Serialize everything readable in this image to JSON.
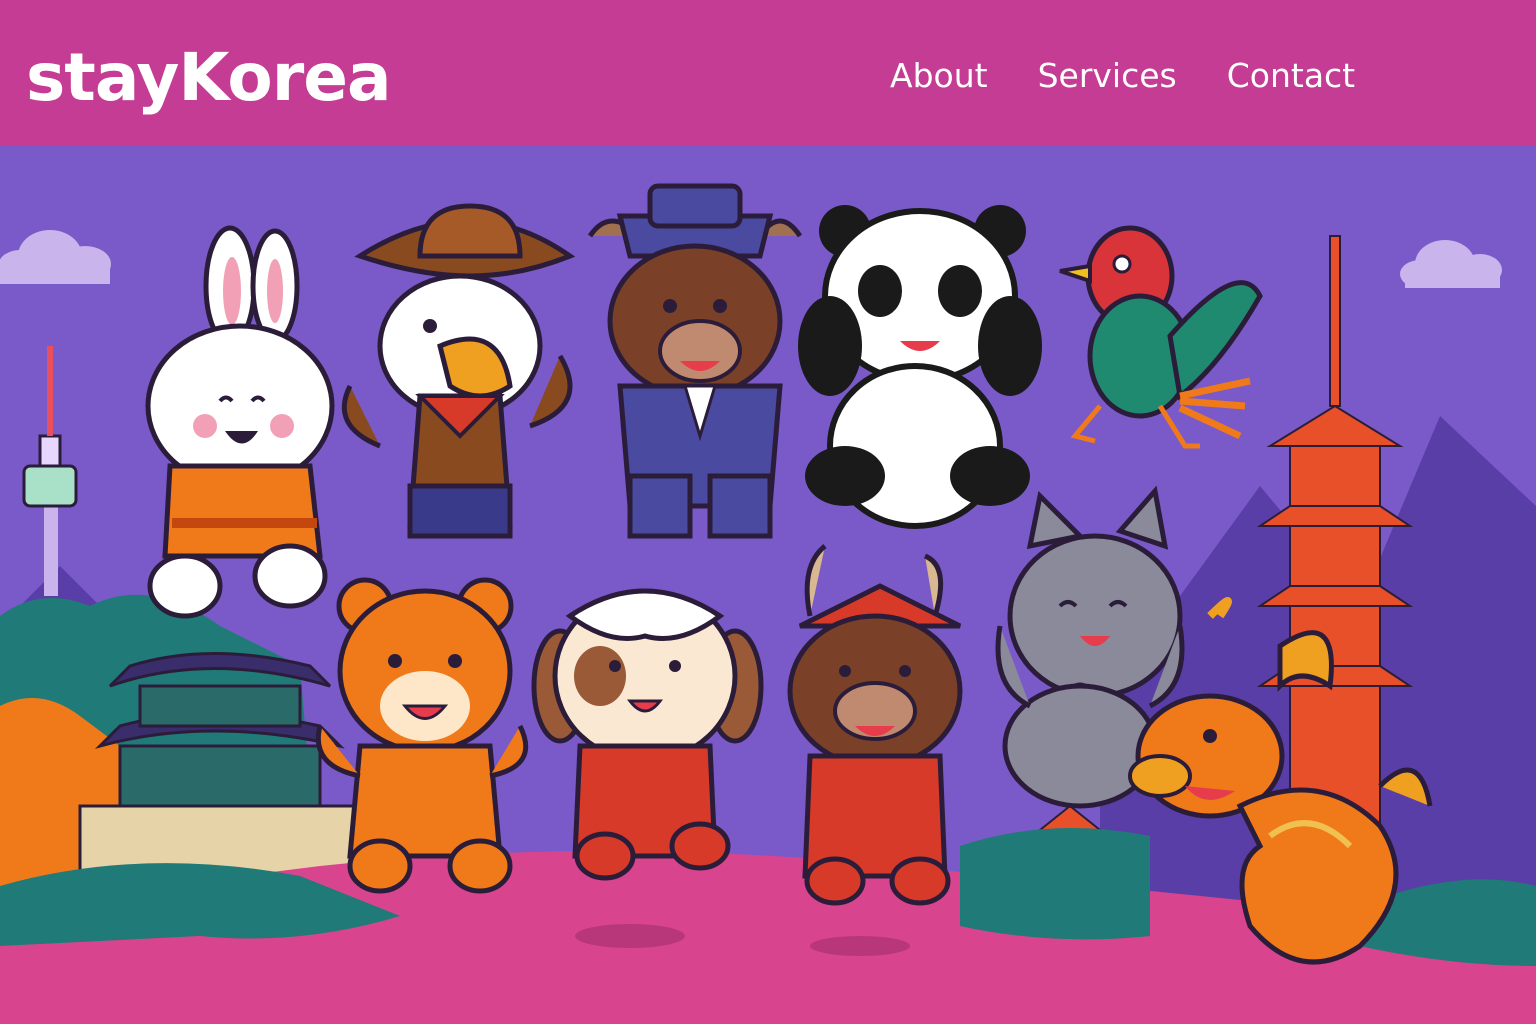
{
  "header": {
    "logo": "stayKorea",
    "nav": [
      {
        "label": "About"
      },
      {
        "label": "Services"
      },
      {
        "label": "Contact"
      }
    ]
  },
  "colors": {
    "header_bg": "#c43c93",
    "sky": "#7a5ac8",
    "ground": "#d8458e",
    "accent_orange": "#f07a1a",
    "pagoda_red": "#e8502a"
  },
  "hero": {
    "characters": [
      "rabbit",
      "eagle",
      "bull",
      "panda",
      "rooster",
      "tiger",
      "dog",
      "ox",
      "cat",
      "dragon"
    ]
  }
}
